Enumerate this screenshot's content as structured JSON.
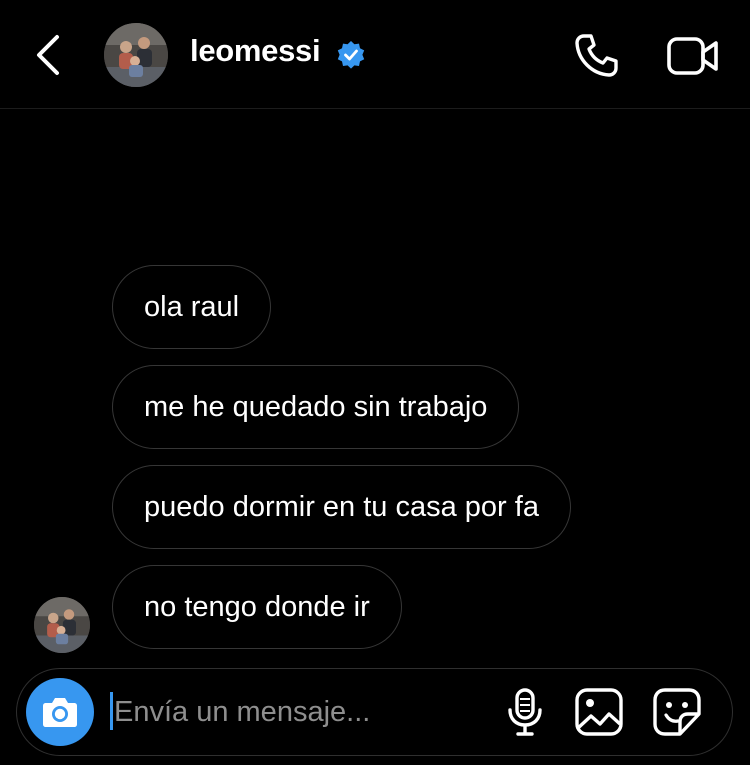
{
  "header": {
    "username": "leomessi",
    "verified": true,
    "back_icon": "chevron-left-icon",
    "call_icon": "phone-icon",
    "video_icon": "video-camera-icon"
  },
  "messages": [
    {
      "text": "ola raul"
    },
    {
      "text": "me he quedado sin trabajo"
    },
    {
      "text": "puedo dormir en tu casa por fa"
    },
    {
      "text": "no tengo donde ir"
    }
  ],
  "composer": {
    "placeholder": "Envía un mensaje...",
    "value": "",
    "camera_icon": "camera-icon",
    "tools": [
      "microphone-icon",
      "gallery-icon",
      "sticker-icon"
    ]
  },
  "colors": {
    "background": "#000000",
    "bubble_border": "#363636",
    "accent": "#3797f0",
    "placeholder": "#8e8e8e"
  }
}
